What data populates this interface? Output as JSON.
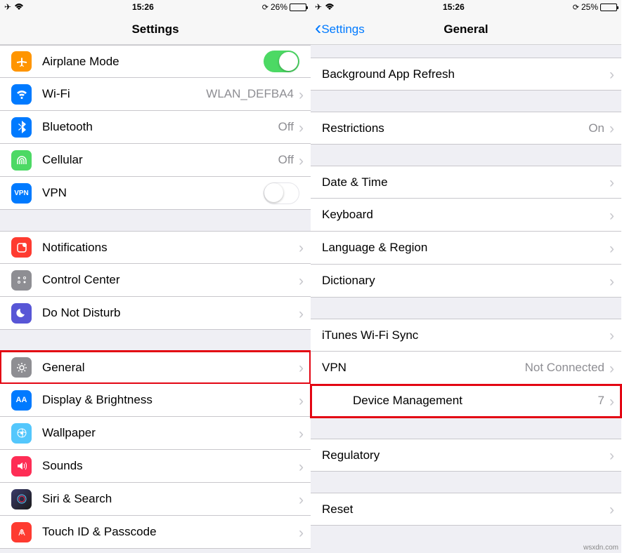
{
  "left": {
    "status": {
      "time": "15:26",
      "battery": "26%",
      "battery_fill": 26
    },
    "nav": {
      "title": "Settings"
    },
    "rows": {
      "airplane": {
        "label": "Airplane Mode",
        "icon_bg": "#ff9500",
        "toggle": true
      },
      "wifi": {
        "label": "Wi-Fi",
        "value": "WLAN_DEFBA4",
        "icon_bg": "#007aff"
      },
      "bluetooth": {
        "label": "Bluetooth",
        "value": "Off",
        "icon_bg": "#007aff"
      },
      "cellular": {
        "label": "Cellular",
        "value": "Off",
        "icon_bg": "#4cd964"
      },
      "vpn": {
        "label": "VPN",
        "icon_bg": "#007aff",
        "toggle": false
      },
      "notifications": {
        "label": "Notifications",
        "icon_bg": "#fe3b30"
      },
      "control": {
        "label": "Control Center",
        "icon_bg": "#8e8e93"
      },
      "dnd": {
        "label": "Do Not Disturb",
        "icon_bg": "#5856d6"
      },
      "general": {
        "label": "General",
        "icon_bg": "#8e8e93"
      },
      "display": {
        "label": "Display & Brightness",
        "icon_bg": "#007aff"
      },
      "wallpaper": {
        "label": "Wallpaper",
        "icon_bg": "#54c7fc"
      },
      "sounds": {
        "label": "Sounds",
        "icon_bg": "#fe2d55"
      },
      "siri": {
        "label": "Siri & Search",
        "icon_bg": "#1a1a1a"
      },
      "touchid": {
        "label": "Touch ID & Passcode",
        "icon_bg": "#fe3b30"
      }
    }
  },
  "right": {
    "status": {
      "time": "15:26",
      "battery": "25%",
      "battery_fill": 25
    },
    "nav": {
      "back": "Settings",
      "title": "General"
    },
    "rows": {
      "bgrefresh": {
        "label": "Background App Refresh"
      },
      "restrictions": {
        "label": "Restrictions",
        "value": "On"
      },
      "datetime": {
        "label": "Date & Time"
      },
      "keyboard": {
        "label": "Keyboard"
      },
      "language": {
        "label": "Language & Region"
      },
      "dictionary": {
        "label": "Dictionary"
      },
      "itunes": {
        "label": "iTunes Wi-Fi Sync"
      },
      "vpn": {
        "label": "VPN",
        "value": "Not Connected"
      },
      "device": {
        "label": "Device Management",
        "value": "7"
      },
      "regulatory": {
        "label": "Regulatory"
      },
      "reset": {
        "label": "Reset"
      }
    }
  },
  "watermark": "wsxdn.com"
}
